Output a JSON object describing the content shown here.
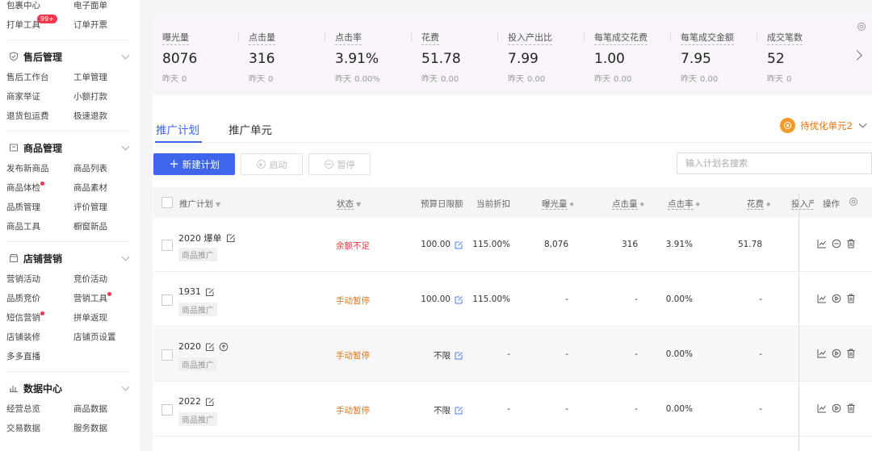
{
  "sidebar": {
    "top_items": [
      {
        "left": "包裹中心",
        "right": "电子面单"
      },
      {
        "left": "打单工具",
        "right": "订单开票",
        "badge": "99+"
      }
    ],
    "sections": [
      {
        "title": "售后管理",
        "icon": "shield-check-icon",
        "items": [
          {
            "left": "售后工作台",
            "right": "工单管理"
          },
          {
            "left": "商家举证",
            "right": "小额打款"
          },
          {
            "left": "退货包运费",
            "right": "极速退款"
          }
        ]
      },
      {
        "title": "商品管理",
        "icon": "box-icon",
        "items": [
          {
            "left": "发布新商品",
            "right": "商品列表"
          },
          {
            "left": "商品体检",
            "right": "商品素材",
            "left_dot": true
          },
          {
            "left": "品质管理",
            "right": "评价管理"
          },
          {
            "left": "商品工具",
            "right": "橱窗新品"
          }
        ]
      },
      {
        "title": "店铺营销",
        "icon": "shop-icon",
        "items": [
          {
            "left": "营销活动",
            "right": "竞价活动"
          },
          {
            "left": "品质竞价",
            "right": "营销工具",
            "right_dot": true
          },
          {
            "left": "短信营销",
            "right": "拼单返现",
            "left_dot": true
          },
          {
            "left": "店铺装修",
            "right": "店铺页设置"
          },
          {
            "left": "多多直播",
            "right": ""
          }
        ]
      },
      {
        "title": "数据中心",
        "icon": "bar-chart-icon",
        "items": [
          {
            "left": "经营总览",
            "right": "商品数据"
          },
          {
            "left": "交易数据",
            "right": "服务数据"
          }
        ]
      }
    ]
  },
  "stats": [
    {
      "label": "曝光量",
      "value": "8076",
      "yesterday_label": "昨天",
      "yesterday": "0"
    },
    {
      "label": "点击量",
      "value": "316",
      "yesterday_label": "昨天",
      "yesterday": "0"
    },
    {
      "label": "点击率",
      "value": "3.91%",
      "yesterday_label": "昨天",
      "yesterday": "0.00%"
    },
    {
      "label": "花费",
      "value": "51.78",
      "yesterday_label": "昨天",
      "yesterday": "0.00"
    },
    {
      "label": "投入产出比",
      "value": "7.99",
      "yesterday_label": "昨天",
      "yesterday": "0.00"
    },
    {
      "label": "每笔成交花费",
      "value": "1.00",
      "yesterday_label": "昨天",
      "yesterday": "0.00"
    },
    {
      "label": "每笔成交金额",
      "value": "7.95",
      "yesterday_label": "昨天",
      "yesterday": "0.00"
    },
    {
      "label": "成交笔数",
      "value": "52",
      "yesterday_label": "昨天",
      "yesterday": "0"
    }
  ],
  "tabs": [
    "推广计划",
    "推广单元"
  ],
  "optimize_label": "待优化单元2",
  "buttons": {
    "new_plan": "新建计划",
    "start": "启动",
    "pause": "暂停"
  },
  "search_placeholder": "输入计划名搜索",
  "table": {
    "headers": {
      "plan": "推广计划",
      "status": "状态",
      "budget": "预算日限额",
      "discount": "当前折扣",
      "impressions": "曝光量",
      "clicks": "点击量",
      "ctr": "点击率",
      "spend": "花费",
      "roi": "投入产",
      "ops": "操作"
    },
    "rows": [
      {
        "name": "2020 爆单",
        "tag": "商品推广",
        "status": "余额不足",
        "status_color": "#e8343b",
        "budget": "100.00",
        "discount": "115.00%",
        "impressions": "8,076",
        "clicks": "316",
        "ctr": "3.91%",
        "spend": "51.78",
        "second_icon": "minus-circle-icon",
        "upload": false
      },
      {
        "name": "1931",
        "tag": "商品推广",
        "status": "手动暂停",
        "status_color": "#e57310",
        "budget": "100.00",
        "discount": "115.00%",
        "impressions": "-",
        "clicks": "-",
        "ctr": "0.00%",
        "spend": "-",
        "second_icon": "play-circle-icon",
        "upload": false
      },
      {
        "name": "2020",
        "tag": "商品推广",
        "status": "手动暂停",
        "status_color": "#e57310",
        "budget": "不限",
        "discount": "-",
        "impressions": "-",
        "clicks": "-",
        "ctr": "0.00%",
        "spend": "-",
        "second_icon": "play-circle-icon",
        "upload": true
      },
      {
        "name": "2022",
        "tag": "商品推广",
        "status": "手动暂停",
        "status_color": "#e57310",
        "budget": "不限",
        "discount": "-",
        "impressions": "-",
        "clicks": "-",
        "ctr": "0.00%",
        "spend": "-",
        "second_icon": "play-circle-icon",
        "upload": false
      }
    ]
  }
}
